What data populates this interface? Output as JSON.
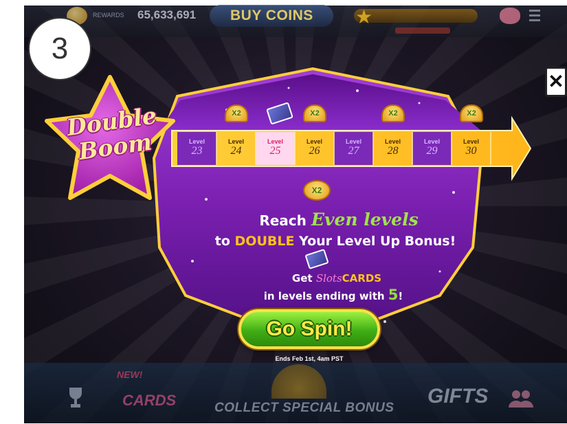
{
  "step_number": "3",
  "top_bar": {
    "rewards_label": "REWARDS",
    "coins_amount": "65,633,691",
    "buy_coins_label": "BUY COINS"
  },
  "popup": {
    "title_line1": "Double",
    "title_line2": "Boom",
    "level_word": "Level",
    "levels": [
      {
        "number": "23",
        "x2": false
      },
      {
        "number": "24",
        "x2": true
      },
      {
        "number": "25",
        "x2": false,
        "card": true
      },
      {
        "number": "26",
        "x2": true
      },
      {
        "number": "27",
        "x2": false
      },
      {
        "number": "28",
        "x2": true
      },
      {
        "number": "29",
        "x2": false
      },
      {
        "number": "30",
        "x2": true
      }
    ],
    "x2_label": "X2",
    "reach_prefix": "Reach ",
    "reach_highlight": "Even levels",
    "bonus_prefix": "to ",
    "bonus_highlight": "DOUBLE",
    "bonus_suffix": " Your Level Up Bonus!",
    "get_prefix": "Get ",
    "slot_word": "Slots",
    "cards_word": "CARDS",
    "ending_prefix": "in levels ending with ",
    "ending_number": "5",
    "ending_suffix": "!",
    "spin_button_label": "Go Spin!",
    "ends_text": "Ends Feb 1st, 4am PST"
  },
  "bottom_bar": {
    "new_label": "NEW!",
    "slot_cards_label": "CARDS",
    "collect_bonus_label": "COLLECT SPECIAL BONUS",
    "gifts_label": "GIFTS"
  },
  "colors": {
    "panel_purple": "#7a1fb0",
    "panel_border_gold": "#ffcf3a",
    "accent_green": "#9fe34a",
    "accent_gold": "#ffc21a",
    "star_magenta": "#c93fcf"
  }
}
